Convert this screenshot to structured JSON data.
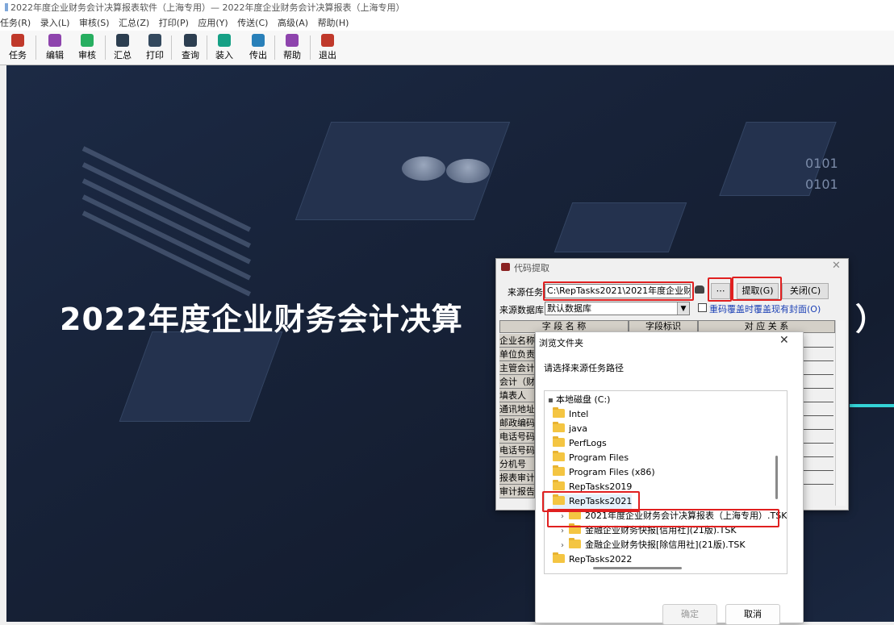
{
  "window": {
    "title": "2022年度企业财务会计决算报表软件（上海专用）— 2022年度企业财务会计决算报表（上海专用）"
  },
  "menu": [
    "任务(R)",
    "录入(L)",
    "审核(S)",
    "汇总(Z)",
    "打印(P)",
    "应用(Y)",
    "传送(C)",
    "高级(A)",
    "帮助(H)"
  ],
  "toolbar": [
    {
      "label": "任务",
      "icon": "task-icon",
      "color": "#c0392b"
    },
    {
      "label": "编辑",
      "icon": "edit-icon",
      "color": "#8e44ad"
    },
    {
      "label": "审核",
      "icon": "check-icon",
      "color": "#27ae60"
    },
    {
      "label": "汇总",
      "icon": "sum-icon",
      "color": "#2c3e50"
    },
    {
      "label": "打印",
      "icon": "print-icon",
      "color": "#34495e"
    },
    {
      "label": "查询",
      "icon": "query-icon",
      "color": "#2c3e50"
    },
    {
      "label": "装入",
      "icon": "load-icon",
      "color": "#16a085"
    },
    {
      "label": "传出",
      "icon": "export-icon",
      "color": "#2980b9"
    },
    {
      "label": "帮助",
      "icon": "help-icon",
      "color": "#8e44ad"
    },
    {
      "label": "退出",
      "icon": "exit-icon",
      "color": "#c0392b"
    }
  ],
  "background": {
    "headline": "2022年度企业财务会计决算",
    "headline_tail": "）",
    "digits_1": "0101",
    "digits_2": "0101"
  },
  "code_dialog": {
    "title": "代码提取",
    "source_task_label": "来源任务",
    "source_task_value": "C:\\RepTasks2021\\2021年度企业财务会",
    "source_db_label": "来源数据库",
    "source_db_value": "默认数据库",
    "extract_button": "提取(G)",
    "close_button": "关闭(C)",
    "overwrite_checkbox": "重码覆盖时覆盖现有封面(O)",
    "columns": [
      "字 段 名 称",
      "字段标识",
      "对 应 关 系"
    ],
    "rows": [
      "企业名称",
      "单位负责",
      "主管会计",
      "会计（财",
      "填表人",
      "通讯地址",
      "邮政编码",
      "电话号码",
      "电话号码",
      "分机号",
      "报表审计",
      "审计报告"
    ]
  },
  "browse_dialog": {
    "title": "浏览文件夹",
    "prompt": "请选择来源任务路径",
    "root": "本地磁盘 (C:)",
    "folders": [
      "Intel",
      "java",
      "PerfLogs",
      "Program Files",
      "Program Files (x86)",
      "RepTasks2019"
    ],
    "selected_folder": "RepTasks2021",
    "children": [
      "2021年度企业财务会计决算报表（上海专用）.TSK",
      "金融企业财务快报[信用社](21版).TSK",
      "金融企业财务快报[除信用社](21版).TSK"
    ],
    "after_folder": "RepTasks2022",
    "ok_button": "确定",
    "cancel_button": "取消"
  }
}
